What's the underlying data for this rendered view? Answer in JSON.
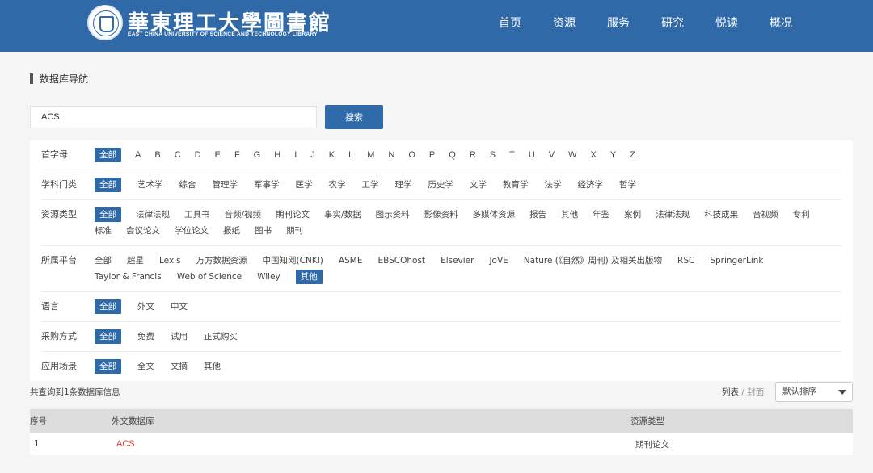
{
  "header": {
    "logo_cn": "華東理工大學圖書館",
    "logo_en": "EAST CHINA UNIVERSITY OF SCIENCE AND TECHNOLOGY LIBRARY",
    "nav": [
      "首页",
      "资源",
      "服务",
      "研究",
      "悦读",
      "概况"
    ],
    "colors": {
      "header_bg": "#2f69a8",
      "accent": "#2f69a8",
      "link_red": "#e23a2c"
    }
  },
  "page": {
    "section_title": "数据库导航"
  },
  "search": {
    "value": "ACS",
    "button": "搜索"
  },
  "filters": [
    {
      "label": "首字母",
      "items": [
        "全部",
        "A",
        "B",
        "C",
        "D",
        "E",
        "F",
        "G",
        "H",
        "I",
        "J",
        "K",
        "L",
        "M",
        "N",
        "O",
        "P",
        "Q",
        "R",
        "S",
        "T",
        "U",
        "V",
        "W",
        "X",
        "Y",
        "Z"
      ],
      "active": 0
    },
    {
      "label": "学科门类",
      "items": [
        "全部",
        "艺术学",
        "综合",
        "管理学",
        "军事学",
        "医学",
        "农学",
        "工学",
        "理学",
        "历史学",
        "文学",
        "教育学",
        "法学",
        "经济学",
        "哲学"
      ],
      "active": 0
    },
    {
      "label": "资源类型",
      "items": [
        "全部",
        "法律法规",
        "工具书",
        "音频/视频",
        "期刊论文",
        "事实/数据",
        "图示资料",
        "影像资料",
        "多媒体资源",
        "报告",
        "其他",
        "年鉴",
        "案例",
        "法律法规",
        "科技成果",
        "音视频",
        "专利",
        "标准",
        "会议论文",
        "学位论文",
        "报纸",
        "图书",
        "期刊"
      ],
      "active": 0
    },
    {
      "label": "所属平台",
      "items": [
        "全部",
        "超星",
        "Lexis",
        "万方数据资源",
        "中国知网(CNKI)",
        "ASME",
        "EBSCOhost",
        "Elsevier",
        "JoVE",
        "Nature (《自然》周刊) 及相关出版物",
        "RSC",
        "SpringerLink",
        "Taylor & Francis",
        "Web of Science",
        "Wiley",
        "其他"
      ],
      "active": 15
    },
    {
      "label": "语言",
      "items": [
        "全部",
        "外文",
        "中文"
      ],
      "active": 0
    },
    {
      "label": "采购方式",
      "items": [
        "全部",
        "免费",
        "试用",
        "正式购买"
      ],
      "active": 0
    },
    {
      "label": "应用场景",
      "items": [
        "全部",
        "全文",
        "文摘",
        "其他"
      ],
      "active": 0
    }
  ],
  "results": {
    "count_text": "共查询到1条数据库信息",
    "view_list": "列表",
    "view_sep": "/",
    "view_cover": "封面",
    "sort_value": "默认排序"
  },
  "table": {
    "headers": {
      "index": "序号",
      "name": "外文数据库",
      "type": "资源类型"
    },
    "rows": [
      {
        "index": "1",
        "name": "ACS",
        "type": "期刊论文"
      }
    ]
  }
}
